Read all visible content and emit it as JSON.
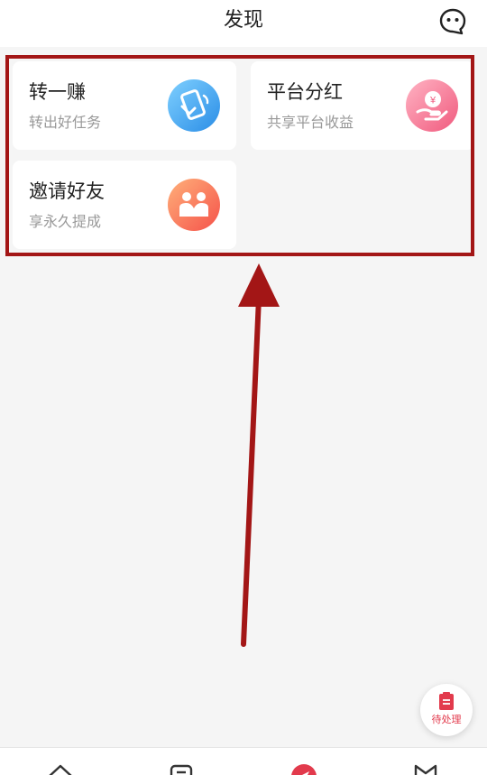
{
  "header": {
    "title": "发现",
    "chat_icon": "chat-bubble-icon"
  },
  "cards": [
    {
      "title": "转一赚",
      "subtitle": "转出好任务",
      "icon": "phone-transfer-icon",
      "color": "#3a9bea"
    },
    {
      "title": "平台分红",
      "subtitle": "共享平台收益",
      "icon": "hand-coin-icon",
      "color": "#f06a8a"
    },
    {
      "title": "邀请好友",
      "subtitle": "享永久提成",
      "icon": "friends-icon",
      "color": "#f6664f"
    }
  ],
  "floating_button": {
    "label": "待处理",
    "icon": "clipboard-icon",
    "color": "#e23a4c"
  },
  "tabbar": {
    "icons": [
      "home-icon",
      "task-icon",
      "discover-icon",
      "profile-icon"
    ],
    "active_color": "#e23a4c"
  },
  "annotation": {
    "color": "#a31616"
  }
}
